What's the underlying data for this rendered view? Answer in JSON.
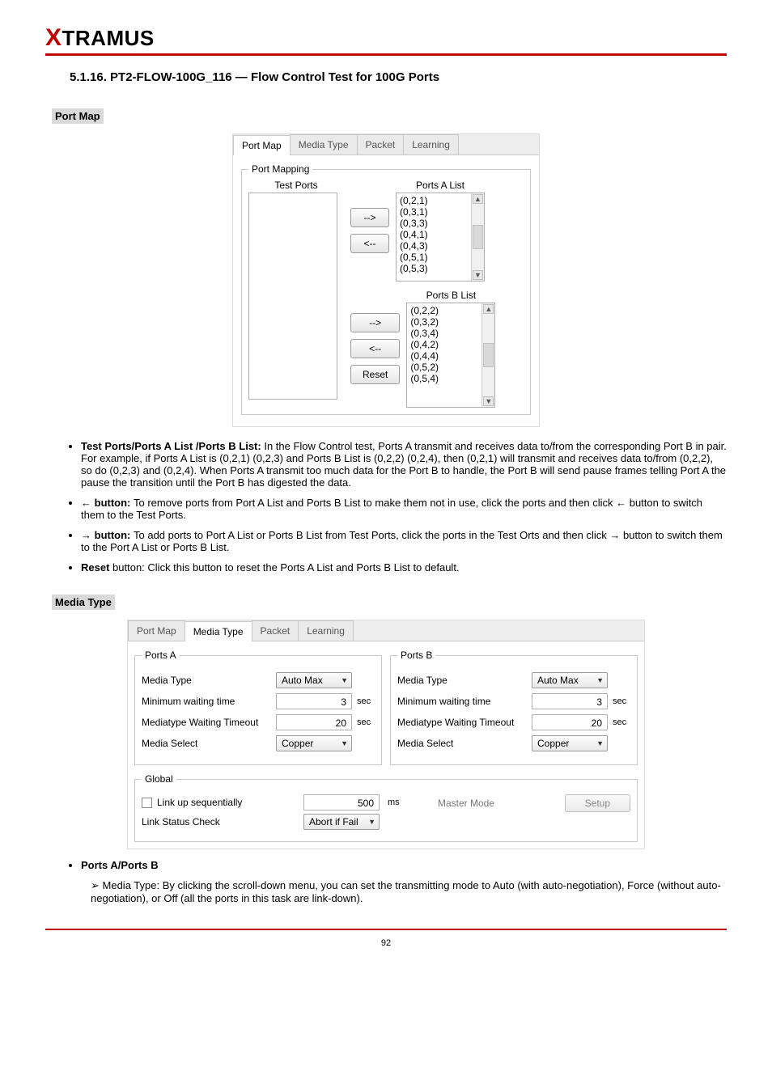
{
  "logo": {
    "x": "X",
    "rest": "TRAMUS"
  },
  "title": "5.1.16. PT2-FLOW-100G_116 — Flow Control Test for 100G Ports",
  "section_portmap": {
    "heading": "Port Map",
    "tabs": {
      "t1": "Port Map",
      "t2": "Media Type",
      "t3": "Packet",
      "t4": "Learning"
    },
    "fieldset_legend": "Port Mapping",
    "test_ports_title": "Test Ports",
    "ports_a_title": "Ports A List",
    "ports_b_title": "Ports B List",
    "ports_a": [
      "(0,2,1)",
      "(0,3,1)",
      "(0,3,3)",
      "(0,4,1)",
      "(0,4,3)",
      "(0,5,1)",
      "(0,5,3)"
    ],
    "ports_b": [
      "(0,2,2)",
      "(0,3,2)",
      "(0,3,4)",
      "(0,4,2)",
      "(0,4,4)",
      "(0,5,2)",
      "(0,5,4)"
    ],
    "btn_right": "-->",
    "btn_left": "<--",
    "btn_reset": "Reset"
  },
  "portmap_bullets": {
    "b1_lead": "Test Ports/Ports A List /Ports B List: ",
    "b1_rest": "In the Flow Control test, Ports A transmit and receives data to/from the corresponding Port B in pair. For example, if Ports A List is (0,2,1) (0,2,3) and Ports B List is (0,2,2) (0,2,4), then (0,2,1) will transmit and receives data to/from (0,2,2), so do (0,2,3) and (0,2,4). When Ports A transmit too much data for the Port B to handle, the Port B will send pause frames telling Port A the pause the transition until the Port B has digested the data.",
    "b2_prefix": "← ",
    "b2_lead": "button: ",
    "b2_rest": "To remove ports from Port A List and Ports B List to make them not in use, click the ports and then click ← button to switch them to the Test Ports.",
    "b3_prefix": "→ ",
    "b3_lead": "button: ",
    "b3_rest": "To add ports to Port A List or Ports B List from Test Ports, click the ports in the Test Orts and then click → button to switch them to the Port A List or Ports B List.",
    "b4_lead": "Reset ",
    "b4_rest": "button: Click this button to reset the Ports A List and Ports B List to default."
  },
  "section_mediatype": {
    "heading": "Media Type",
    "tabs": {
      "t1": "Port Map",
      "t2": "Media Type",
      "t3": "Packet",
      "t4": "Learning"
    },
    "ports_a_legend": "Ports A",
    "ports_b_legend": "Ports B",
    "global_legend": "Global",
    "labels": {
      "media_type": "Media Type",
      "min_wait": "Minimum waiting time",
      "mt_timeout": "Mediatype Waiting Timeout",
      "media_select": "Media Select",
      "link_seq": "Link up sequentially",
      "link_status": "Link Status Check",
      "master_mode": "Master Mode"
    },
    "values": {
      "media_type": "Auto Max",
      "min_wait": "3",
      "mt_timeout": "20",
      "media_select": "Copper",
      "link_seq_ms": "500",
      "link_status": "Abort if Fail"
    },
    "units": {
      "sec": "sec",
      "ms": "ms"
    },
    "setup_btn": "Setup"
  },
  "mediatype_desc": {
    "b1_lead": "Ports A/Ports B",
    "a1_lead": "Media Type: ",
    "a1_rest": "By clicking the scroll-down menu, you can set the transmitting mode to Auto (with auto-negotiation), Force (without auto-negotiation), or Off (all the ports in this task are link-down)."
  },
  "footer": "92"
}
